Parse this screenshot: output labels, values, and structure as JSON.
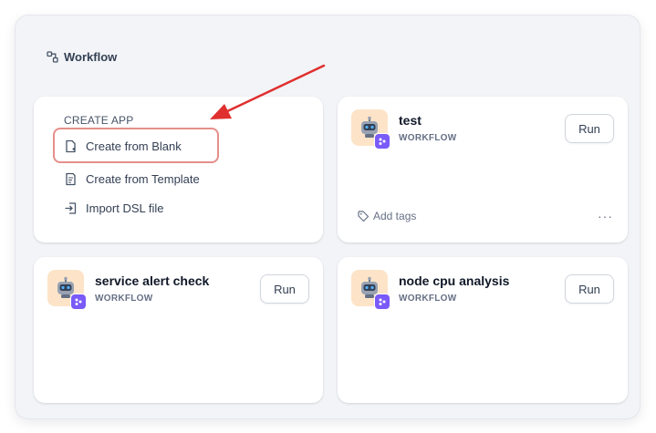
{
  "header": {
    "title": "Workflow",
    "icon": "workflow-icon"
  },
  "create_app": {
    "title": "CREATE APP",
    "items": [
      {
        "label": "Create from Blank",
        "icon": "blank-doc-icon",
        "highlighted": true
      },
      {
        "label": "Create from Template",
        "icon": "template-icon"
      },
      {
        "label": "Import DSL file",
        "icon": "import-icon"
      }
    ]
  },
  "apps": [
    {
      "name": "test",
      "type": "WORKFLOW",
      "run_label": "Run",
      "add_tags_label": "Add tags",
      "more_label": "···"
    },
    {
      "name": "service alert check",
      "type": "WORKFLOW",
      "run_label": "Run"
    },
    {
      "name": "node cpu analysis",
      "type": "WORKFLOW",
      "run_label": "Run"
    }
  ],
  "colors": {
    "highlight": "#e58f8a",
    "annotation_arrow": "#e02f2f",
    "badge": "#7a5af8",
    "app_icon_bg": "#fde4c8"
  }
}
